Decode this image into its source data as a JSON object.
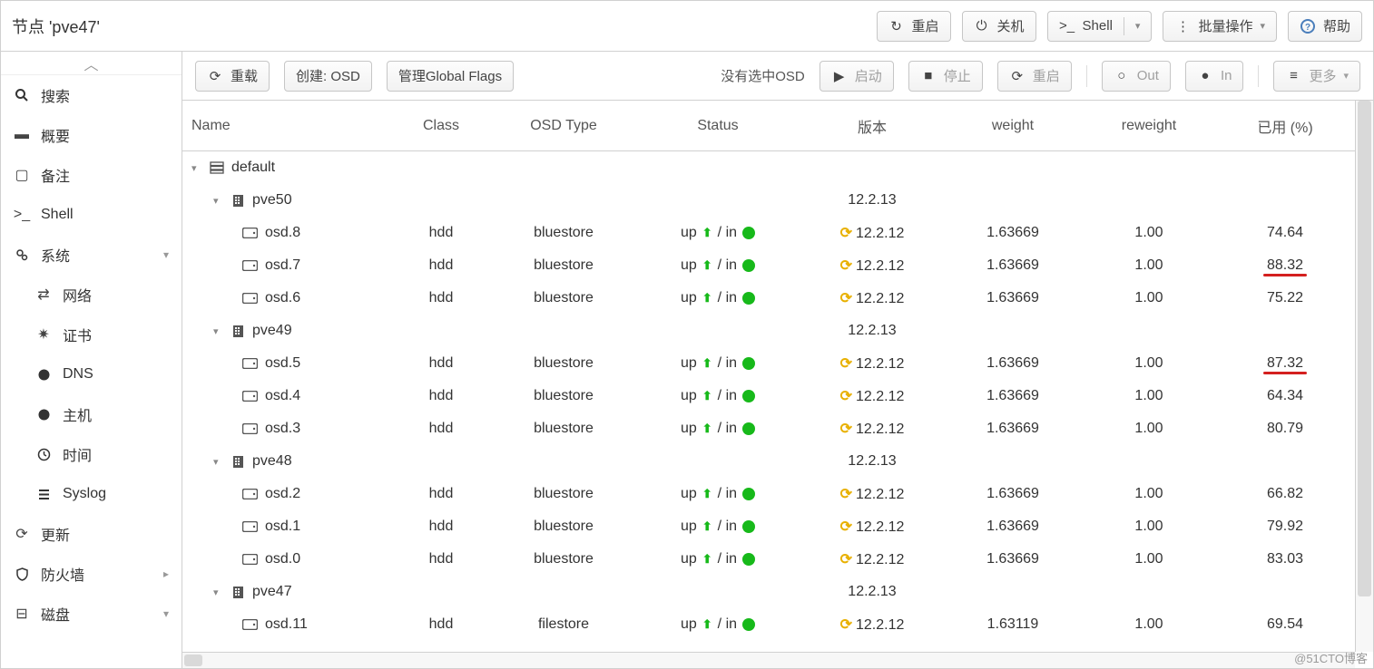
{
  "header": {
    "title": "节点 'pve47'"
  },
  "topActions": {
    "restart": "重启",
    "shutdown": "关机",
    "shell": "Shell",
    "bulk": "批量操作",
    "help": "帮助"
  },
  "sidebar": {
    "items": [
      {
        "key": "search",
        "label": "搜索",
        "icon": "search"
      },
      {
        "key": "summary",
        "label": "概要",
        "icon": "book"
      },
      {
        "key": "notes",
        "label": "备注",
        "icon": "sticky"
      },
      {
        "key": "shell",
        "label": "Shell",
        "icon": "terminal"
      },
      {
        "key": "system",
        "label": "系统",
        "icon": "gears",
        "expandable": true
      }
    ],
    "systemChildren": [
      {
        "key": "network",
        "label": "网络",
        "icon": "exchange"
      },
      {
        "key": "certs",
        "label": "证书",
        "icon": "cert"
      },
      {
        "key": "dns",
        "label": "DNS",
        "icon": "globe"
      },
      {
        "key": "host",
        "label": "主机",
        "icon": "globe"
      },
      {
        "key": "time",
        "label": "时间",
        "icon": "clock"
      },
      {
        "key": "syslog",
        "label": "Syslog",
        "icon": "list"
      }
    ],
    "tail": [
      {
        "key": "update",
        "label": "更新",
        "icon": "refresh"
      },
      {
        "key": "firewall",
        "label": "防火墙",
        "icon": "shield",
        "expandable": true
      },
      {
        "key": "disk",
        "label": "磁盘",
        "icon": "hdd",
        "expandable": true
      }
    ]
  },
  "toolbar": {
    "reload": "重载",
    "create": "创建: OSD",
    "flags": "管理Global Flags",
    "msg": "没有选中OSD",
    "start": "启动",
    "stop": "停止",
    "restart": "重启",
    "out": "Out",
    "in": "In",
    "more": "更多"
  },
  "columns": {
    "name": "Name",
    "class": "Class",
    "type": "OSD Type",
    "status": "Status",
    "version": "版本",
    "weight": "weight",
    "reweight": "reweight",
    "used": "已用 (%)"
  },
  "tree": {
    "root": {
      "label": "default"
    },
    "hosts": [
      {
        "name": "pve50",
        "version": "12.2.13",
        "osds": [
          {
            "name": "osd.8",
            "class": "hdd",
            "type": "bluestore",
            "status_up": "up",
            "status_in": "in",
            "version": "12.2.12",
            "weight": "1.63669",
            "reweight": "1.00",
            "used": "74.64"
          },
          {
            "name": "osd.7",
            "class": "hdd",
            "type": "bluestore",
            "status_up": "up",
            "status_in": "in",
            "version": "12.2.12",
            "weight": "1.63669",
            "reweight": "1.00",
            "used": "88.32",
            "mark": true
          },
          {
            "name": "osd.6",
            "class": "hdd",
            "type": "bluestore",
            "status_up": "up",
            "status_in": "in",
            "version": "12.2.12",
            "weight": "1.63669",
            "reweight": "1.00",
            "used": "75.22"
          }
        ]
      },
      {
        "name": "pve49",
        "version": "12.2.13",
        "osds": [
          {
            "name": "osd.5",
            "class": "hdd",
            "type": "bluestore",
            "status_up": "up",
            "status_in": "in",
            "version": "12.2.12",
            "weight": "1.63669",
            "reweight": "1.00",
            "used": "87.32",
            "mark": true
          },
          {
            "name": "osd.4",
            "class": "hdd",
            "type": "bluestore",
            "status_up": "up",
            "status_in": "in",
            "version": "12.2.12",
            "weight": "1.63669",
            "reweight": "1.00",
            "used": "64.34"
          },
          {
            "name": "osd.3",
            "class": "hdd",
            "type": "bluestore",
            "status_up": "up",
            "status_in": "in",
            "version": "12.2.12",
            "weight": "1.63669",
            "reweight": "1.00",
            "used": "80.79"
          }
        ]
      },
      {
        "name": "pve48",
        "version": "12.2.13",
        "osds": [
          {
            "name": "osd.2",
            "class": "hdd",
            "type": "bluestore",
            "status_up": "up",
            "status_in": "in",
            "version": "12.2.12",
            "weight": "1.63669",
            "reweight": "1.00",
            "used": "66.82"
          },
          {
            "name": "osd.1",
            "class": "hdd",
            "type": "bluestore",
            "status_up": "up",
            "status_in": "in",
            "version": "12.2.12",
            "weight": "1.63669",
            "reweight": "1.00",
            "used": "79.92"
          },
          {
            "name": "osd.0",
            "class": "hdd",
            "type": "bluestore",
            "status_up": "up",
            "status_in": "in",
            "version": "12.2.12",
            "weight": "1.63669",
            "reweight": "1.00",
            "used": "83.03"
          }
        ]
      },
      {
        "name": "pve47",
        "version": "12.2.13",
        "osds": [
          {
            "name": "osd.11",
            "class": "hdd",
            "type": "filestore",
            "status_up": "up",
            "status_in": "in",
            "version": "12.2.12",
            "weight": "1.63119",
            "reweight": "1.00",
            "used": "69.54"
          }
        ]
      }
    ]
  },
  "watermark": "@51CTO博客"
}
